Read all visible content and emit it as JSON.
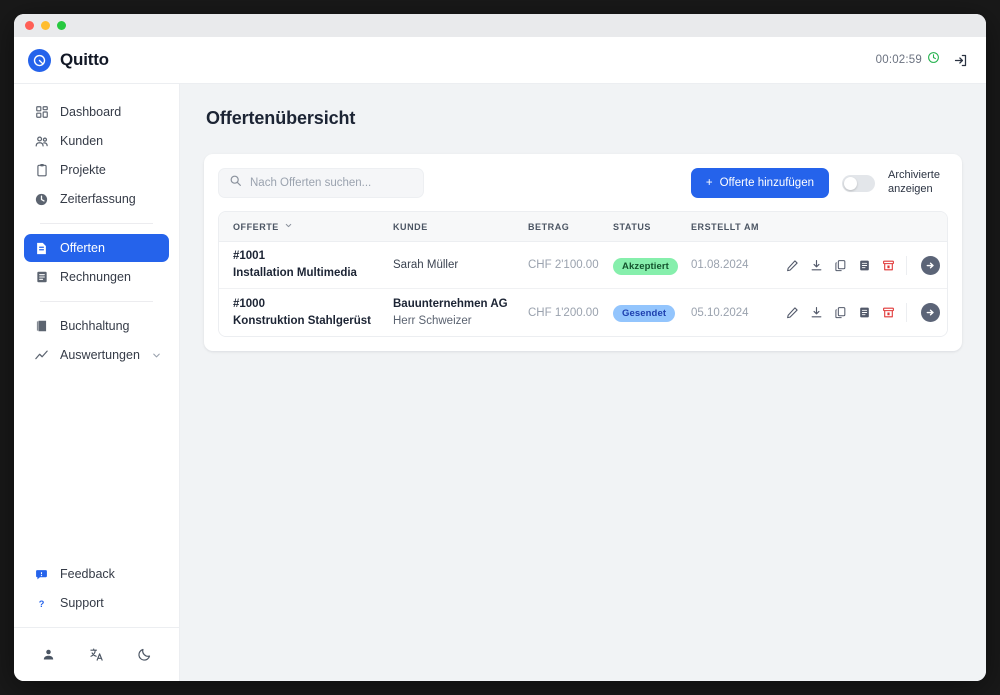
{
  "window": {
    "traffic_lights": [
      "close",
      "minimize",
      "maximize"
    ]
  },
  "header": {
    "brand": "Quitto",
    "logo_icon": "quitto-logo-icon",
    "timer": "00:02:59",
    "timer_icon": "clock-icon",
    "logout_icon": "logout-icon"
  },
  "sidebar": {
    "items": [
      {
        "label": "Dashboard",
        "icon": "grid-icon",
        "active": false
      },
      {
        "label": "Kunden",
        "icon": "users-icon",
        "active": false
      },
      {
        "label": "Projekte",
        "icon": "clipboard-icon",
        "active": false
      },
      {
        "label": "Zeiterfassung",
        "icon": "clock-icon",
        "active": false
      },
      {
        "label": "Offerten",
        "icon": "offer-document-icon",
        "active": true
      },
      {
        "label": "Rechnungen",
        "icon": "invoice-icon",
        "active": false
      },
      {
        "label": "Buchhaltung",
        "icon": "book-icon",
        "active": false
      },
      {
        "label": "Auswertungen",
        "icon": "chart-line-icon",
        "active": false,
        "chevron": "chevron-down-icon"
      }
    ],
    "bottom_items": [
      {
        "label": "Feedback",
        "icon": "chat-icon"
      },
      {
        "label": "Support",
        "icon": "question-icon"
      }
    ],
    "footer_icons": [
      "user-icon",
      "translate-icon",
      "moon-icon"
    ]
  },
  "main": {
    "page_title": "Offertenübersicht",
    "toolbar": {
      "search_placeholder": "Nach Offerten suchen...",
      "search_value": "",
      "search_icon": "search-icon",
      "add_button": "Offerte hinzufügen",
      "add_button_plus": "+",
      "toggle_on": false,
      "toggle_label": "Archivierte anzeigen"
    },
    "table": {
      "columns": [
        "OFFERTE",
        "KUNDE",
        "BETRAG",
        "STATUS",
        "ERSTELLT AM"
      ],
      "sort_icon": "chevron-down-icon",
      "rows": [
        {
          "number": "#1001",
          "title": "Installation Multimedia",
          "customer": "Sarah Müller",
          "customer_contact": "",
          "amount": "CHF 2'100.00",
          "status": "Akzeptiert",
          "status_kind": "accepted",
          "created": "01.08.2024",
          "actions": [
            "edit-icon",
            "download-icon",
            "copy-icon",
            "invoice-icon",
            "archive-icon"
          ],
          "open_icon": "arrow-right-icon"
        },
        {
          "number": "#1000",
          "title": "Konstruktion Stahlgerüst",
          "customer": "Bauunternehmen AG",
          "customer_contact": "Herr Schweizer",
          "amount": "CHF 1'200.00",
          "status": "Gesendet",
          "status_kind": "sent",
          "created": "05.10.2024",
          "actions": [
            "edit-icon",
            "download-icon",
            "copy-icon",
            "invoice-icon",
            "archive-icon"
          ],
          "open_icon": "arrow-right-icon"
        }
      ]
    }
  },
  "colors": {
    "accent": "#2563eb",
    "status_accepted_bg": "#86efac",
    "status_sent_bg": "#93c5fd",
    "danger": "#e03636",
    "page_bg": "#f1f3f5"
  }
}
